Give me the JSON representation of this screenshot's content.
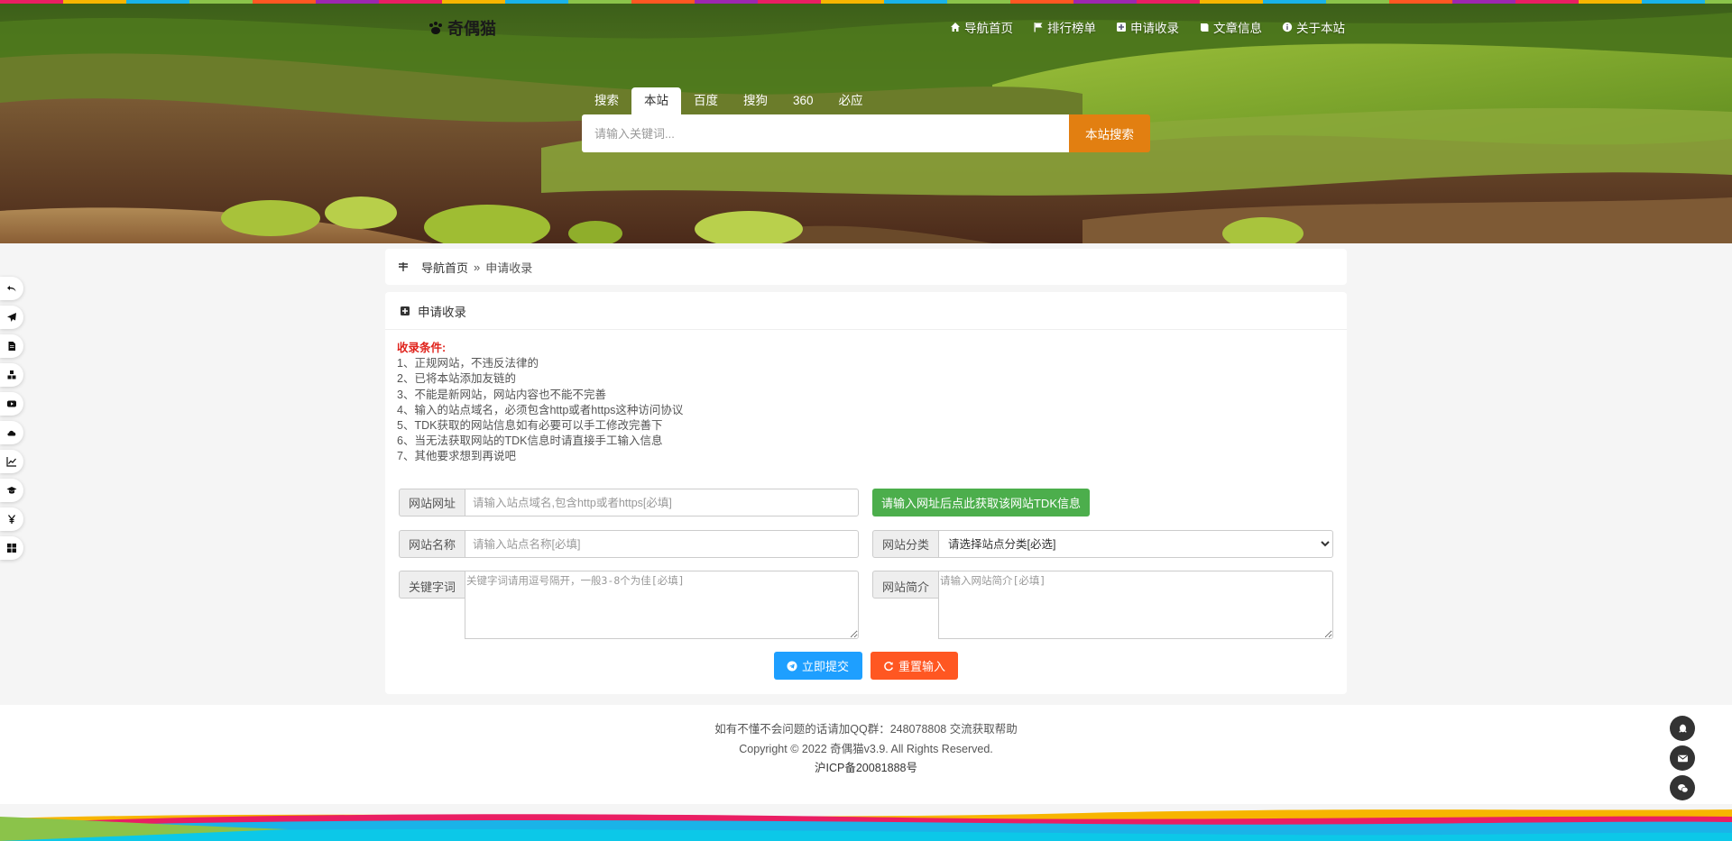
{
  "logo": {
    "text": "奇偶猫"
  },
  "nav": [
    {
      "label": "导航首页",
      "icon": "home-icon"
    },
    {
      "label": "排行榜单",
      "icon": "flag-icon"
    },
    {
      "label": "申请收录",
      "icon": "plus-square-icon"
    },
    {
      "label": "文章信息",
      "icon": "book-icon"
    },
    {
      "label": "关于本站",
      "icon": "info-circle-icon"
    }
  ],
  "search": {
    "label": "搜索",
    "tabs": [
      "本站",
      "百度",
      "搜狗",
      "360",
      "必应"
    ],
    "active_tab": "本站",
    "placeholder": "请输入关键词...",
    "button": "本站搜索"
  },
  "side_left_icons": [
    "undo-icon",
    "paper-plane-icon",
    "file-icon",
    "cubes-icon",
    "youtube-icon",
    "cloud-icon",
    "line-chart-icon",
    "graduation-cap-icon",
    "yen-icon",
    "th-large-icon"
  ],
  "breadcrumb": {
    "home": "导航首页",
    "separator": "»",
    "current": "申请收录"
  },
  "panel": {
    "title": "申请收录",
    "rules_title": "收录条件:",
    "rules": [
      "1、正规网站，不违反法律的",
      "2、已将本站添加友链的",
      "3、不能是新网站，网站内容也不能不完善",
      "4、输入的站点域名，必须包含http或者https这种访问协议",
      "5、TDK获取的网站信息如有必要可以手工修改完善下",
      "6、当无法获取网站的TDK信息时请直接手工输入信息",
      "7、其他要求想到再说吧"
    ]
  },
  "form": {
    "url": {
      "label": "网站网址",
      "placeholder": "请输入站点域名,包含http或者https[必填]"
    },
    "tdk_button": "请输入网址后点此获取该网站TDK信息",
    "name": {
      "label": "网站名称",
      "placeholder": "请输入站点名称[必填]"
    },
    "category": {
      "label": "网站分类",
      "selected": "请选择站点分类[必选]"
    },
    "keywords": {
      "label": "关键字词",
      "placeholder": "关键字词请用逗号隔开，一般3-8个为佳[必填]"
    },
    "description": {
      "label": "网站简介",
      "placeholder": "请输入网站简介[必填]"
    },
    "submit": "立即提交",
    "reset": "重置输入"
  },
  "footer": {
    "line1": "如有不懂不会问题的话请加QQ群：248078808 交流获取帮助",
    "line2": "Copyright © 2022 奇偶猫v3.9. All Rights Reserved.",
    "line3": "沪ICP备20081888号"
  },
  "side_right_icons": [
    "qq-icon",
    "envelope-icon",
    "wechat-icon"
  ],
  "colors": {
    "search_button": "#e27f11",
    "tdk_button": "#4cae4c",
    "submit": "#1e9fff",
    "reset": "#ff5722",
    "rules_title": "#e0231c"
  }
}
